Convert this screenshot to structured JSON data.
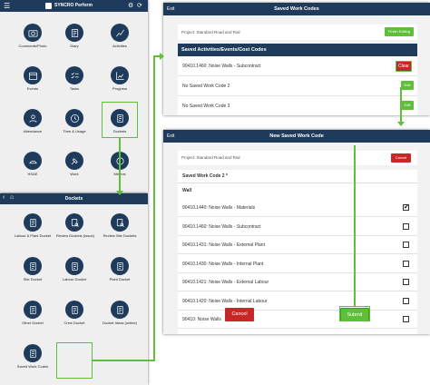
{
  "phone1": {
    "title": "SYNCRO Perform",
    "tiles": [
      {
        "label": "Comments/Photo",
        "icon": "camera-icon"
      },
      {
        "label": "Diary",
        "icon": "diary-icon"
      },
      {
        "label": "Activities",
        "icon": "activities-icon"
      },
      {
        "label": "Events",
        "icon": "events-icon"
      },
      {
        "label": "Tasks",
        "icon": "tasks-icon"
      },
      {
        "label": "Progress",
        "icon": "progress-icon"
      },
      {
        "label": "Attendance",
        "icon": "attendance-icon"
      },
      {
        "label": "Time & Usage",
        "icon": "clock-icon"
      },
      {
        "label": "Dockets",
        "icon": "docket-icon"
      },
      {
        "label": "HSAE",
        "icon": "helmet-icon"
      },
      {
        "label": "Work",
        "icon": "work-icon"
      },
      {
        "label": "Memos",
        "icon": "memo-icon"
      }
    ]
  },
  "phone2": {
    "title": "Dockets",
    "tiles": [
      {
        "label": "Labour & Plant Docket",
        "icon": "docket-icon"
      },
      {
        "label": "Review Dockets (Issue)",
        "icon": "review-icon"
      },
      {
        "label": "Review Site Dockets",
        "icon": "review-icon"
      },
      {
        "label": "Site Docket",
        "icon": "docket-icon"
      },
      {
        "label": "Labour Docket",
        "icon": "docket-icon"
      },
      {
        "label": "Plant Docket",
        "icon": "docket-icon"
      },
      {
        "label": "Other Docket",
        "icon": "docket-icon"
      },
      {
        "label": "Crew Docket",
        "icon": "docket-icon"
      },
      {
        "label": "Docket Ideas (online)",
        "icon": "docket-icon"
      },
      {
        "label": "Saved Work Codes",
        "icon": "docket-icon"
      }
    ]
  },
  "saved": {
    "exit": "Exit",
    "title": "Saved Work Codes",
    "project": "Project: Standard Road and Rail",
    "finish": "Finish Editing",
    "section": "Saved Activities/Events/Cost Codes",
    "rows": [
      {
        "text": "90410.1460: Noise Walls - Subcontract",
        "action": "Clear"
      },
      {
        "text": "No Saved Work Code 2",
        "action": "Edit"
      },
      {
        "text": "No Saved Work Code 3",
        "action": "Edit"
      }
    ]
  },
  "newcode": {
    "exit": "Exit",
    "title": "New Saved Work Code",
    "project": "Project: Standard Road and Rail",
    "cancel_small": "Cancel",
    "code_label": "Saved Work Code 2 *",
    "group": "Wall",
    "items": [
      {
        "text": "90410.1440: Noise Walls - Materials",
        "checked": true
      },
      {
        "text": "90410.1460: Noise Walls - Subcontract",
        "checked": false
      },
      {
        "text": "90410.1431: Noise Walls - External Plant",
        "checked": false
      },
      {
        "text": "90410.1430: Noise Walls - Internal Plant",
        "checked": false
      },
      {
        "text": "90410.1421: Noise Walls - External Labour",
        "checked": false
      },
      {
        "text": "90410.1420: Noise Walls - Internal Labour",
        "checked": false
      },
      {
        "text": "90410: Noise Walls",
        "checked": false
      }
    ],
    "cancel": "Cancel",
    "submit": "Submit"
  },
  "colors": {
    "navy": "#1f3b5c",
    "green": "#5fbf3a",
    "red": "#c62828"
  }
}
